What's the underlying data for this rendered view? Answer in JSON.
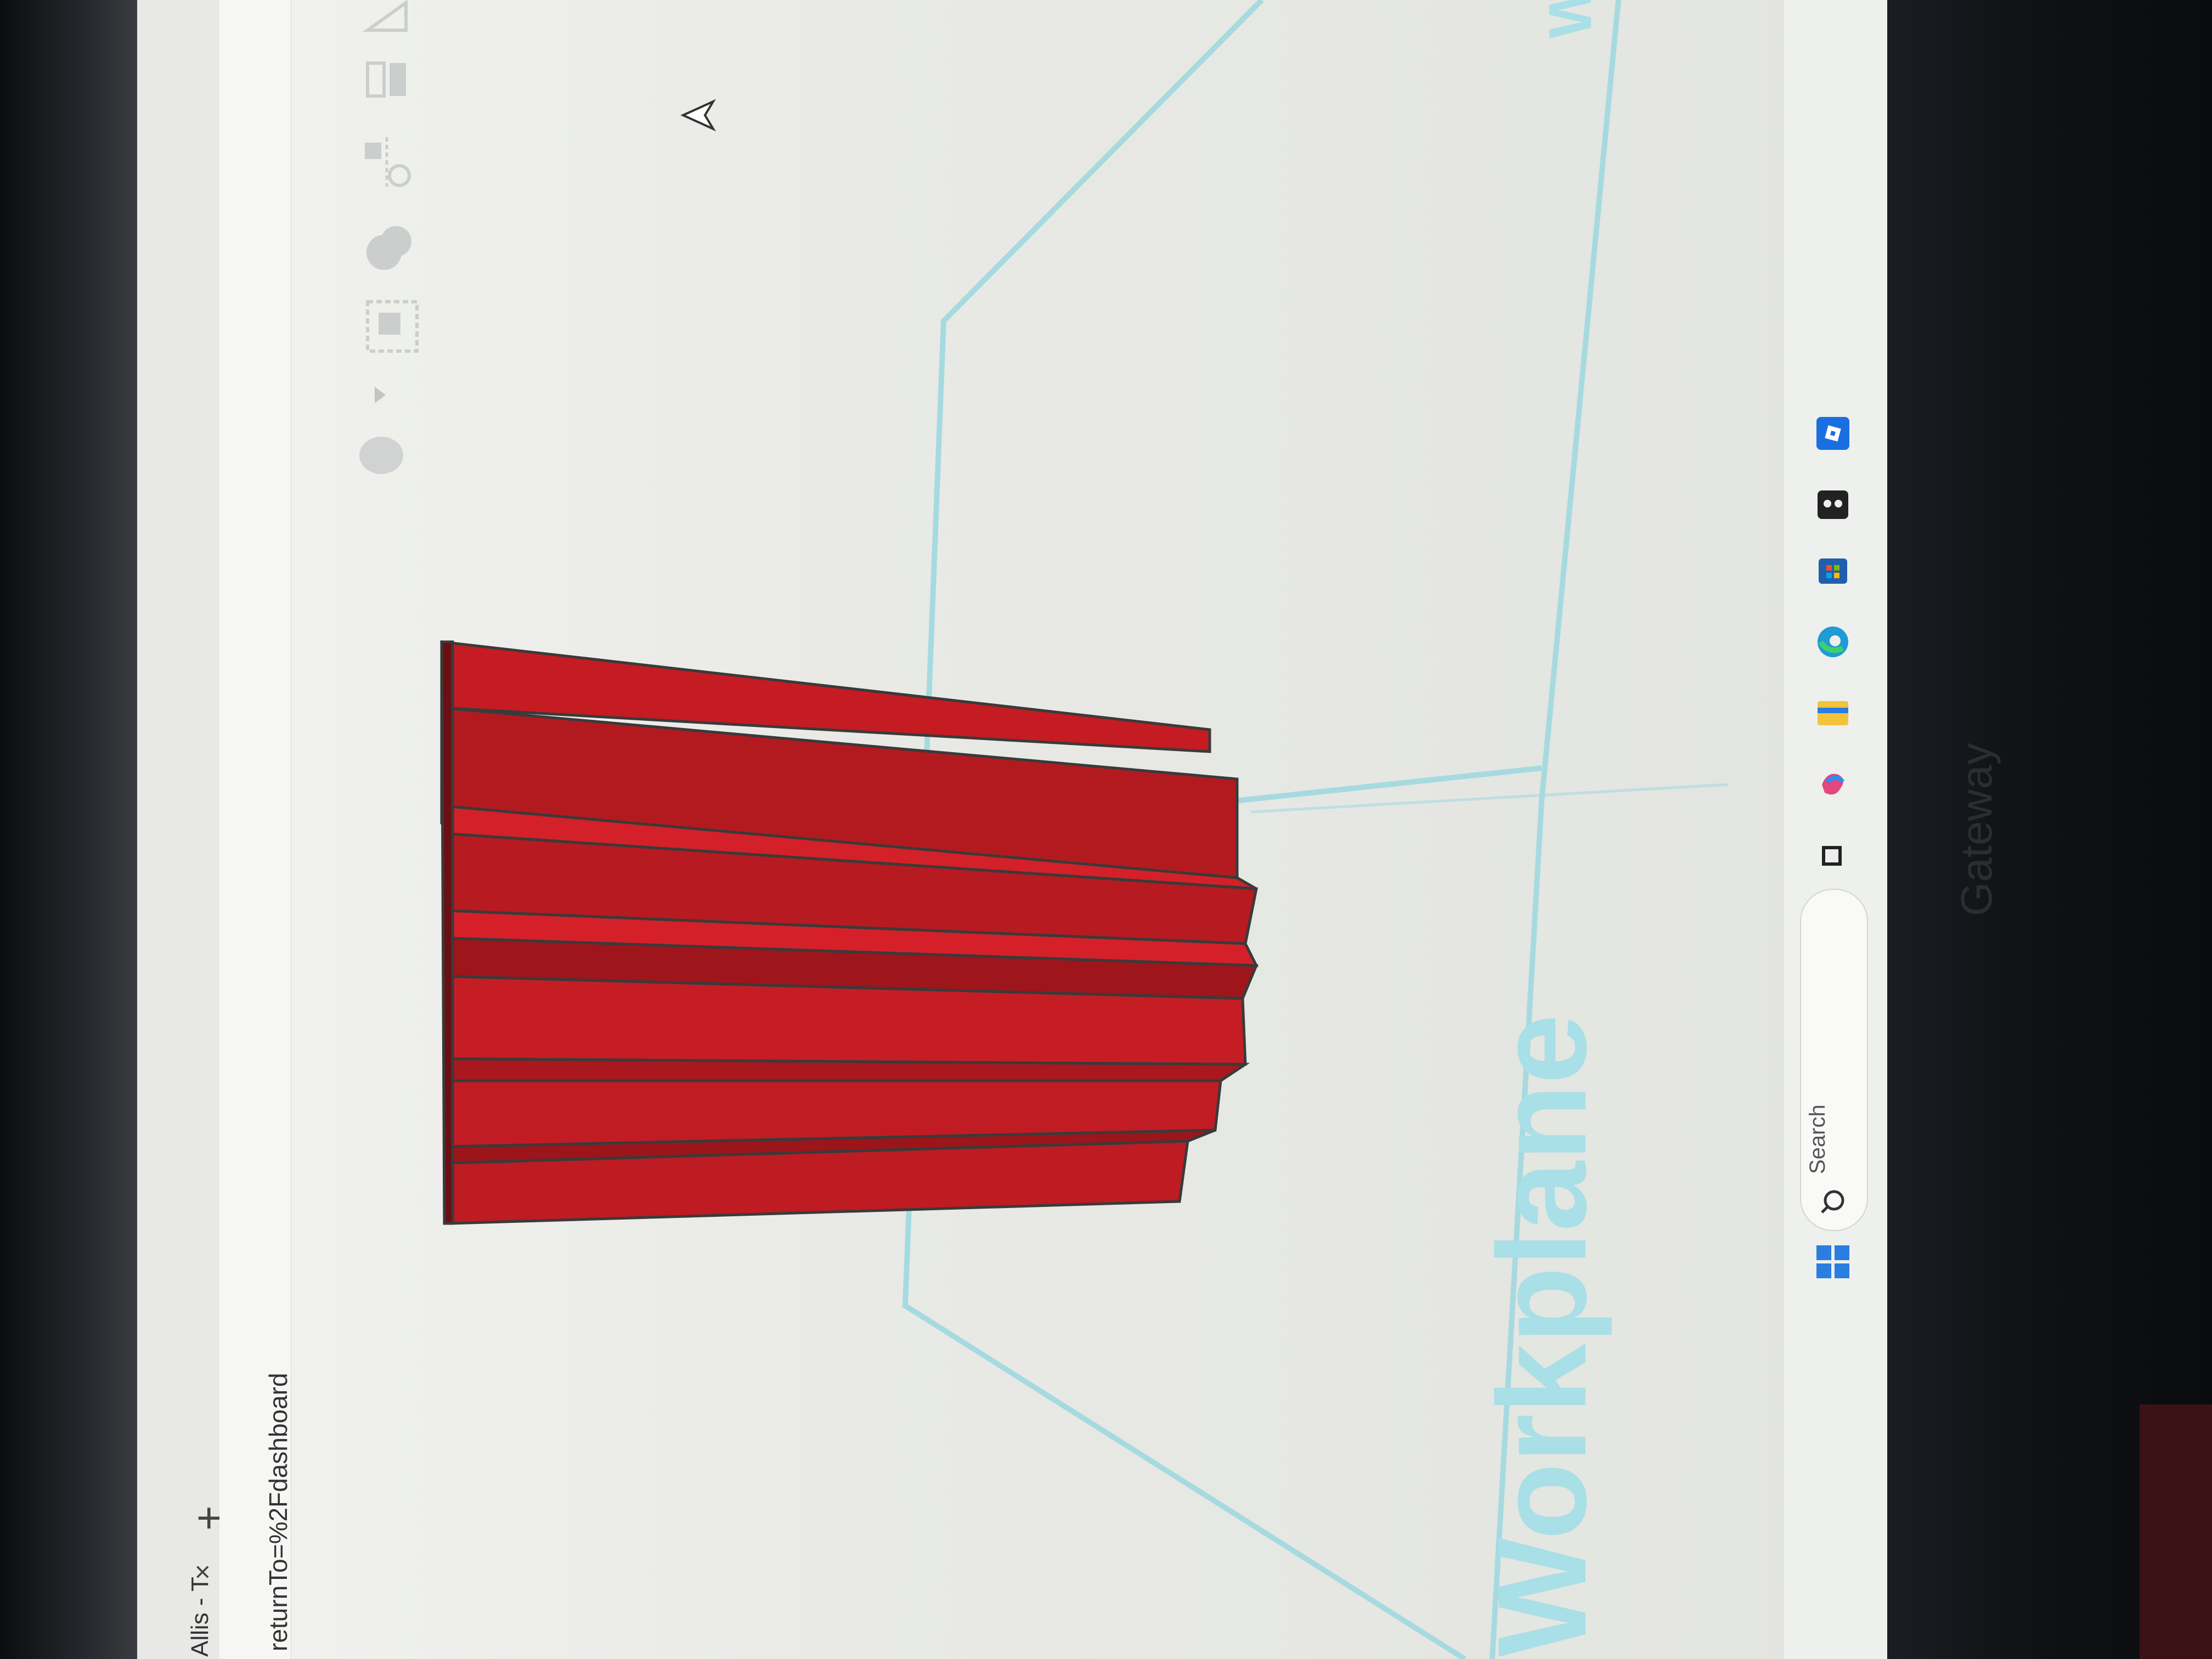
{
  "browser": {
    "tab_label": "Allis - T",
    "tab_close": "×",
    "tab_add": "+",
    "address_text": "returnTo=%2Fdashboard"
  },
  "viewport": {
    "workplane_label": "Workplane",
    "workplane_label_partial": "W",
    "shape_color": "#c81e24"
  },
  "taskbar": {
    "search_placeholder": "Search",
    "icons": [
      "windows-start-icon",
      "search-icon",
      "task-view-icon",
      "copilot-icon",
      "file-explorer-icon",
      "edge-icon",
      "store-icon",
      "game-app-icon",
      "roblox-icon"
    ]
  },
  "hardware": {
    "brand": "Gateway"
  }
}
